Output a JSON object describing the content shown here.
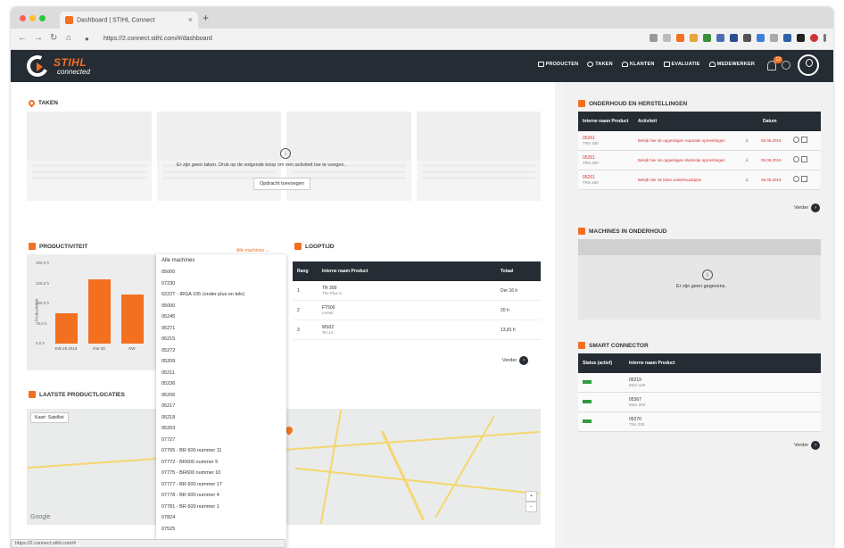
{
  "browser": {
    "tab_title": "Dashboard | STIHL Connect",
    "url": "https://2.connect.stihl.com/#/dashboard",
    "status_url": "https://2.connect.stihl.com/#"
  },
  "header": {
    "brand": "STIHL",
    "brand_sub": "connected",
    "menu": [
      "PRODUCTEN",
      "TAKEN",
      "KLANTEN",
      "EVALUATIE",
      "MEDEWERKER"
    ],
    "notification_count": "12"
  },
  "taken": {
    "title": "TAKEN",
    "message": "Er zijn geen taken. Druk op de volgende knop om een activiteit toe te voegen.",
    "button": "Opdracht toevoegen"
  },
  "productiviteit": {
    "title": "PRODUCTIVITEIT",
    "dropdown_value": "Alle machines",
    "chart_data": {
      "type": "bar",
      "ylabel": "Productiviteit",
      "yticks": [
        "300,0 h",
        "225,0 h",
        "150,0 h",
        "75,0 h",
        "0,0 h"
      ],
      "categories": [
        "KW 29 2019",
        "KW 30",
        "KW"
      ],
      "values": [
        115,
        240,
        185
      ],
      "ylim": [
        0,
        300
      ]
    },
    "machines": [
      "Alle machines",
      "05000",
      "07230",
      "0222T - IRGA 105 (onder plus en tele)",
      "05000",
      "05245",
      "05271",
      "05215",
      "05272",
      "05209",
      "05211",
      "05236",
      "05206",
      "05217",
      "05218",
      "05203",
      "07727",
      "07765 - BR 600 nummer 11",
      "07772 - BR600 nummer 5",
      "07775 - BR600 nummer 10",
      "07777 - BR 600 nummer 17",
      "07778 - BR 600 nummer 4",
      "07781 - BR 600 nummer 1",
      "07824",
      "07525"
    ]
  },
  "looptijd": {
    "title": "LOOPTIJD",
    "columns": [
      "Rang",
      "Interne naam Product",
      "Totaal"
    ],
    "rows": [
      {
        "rank": "1",
        "name": "TR 300",
        "sub": "The Plus S",
        "total": "Der 16 h"
      },
      {
        "rank": "2",
        "name": "FT500",
        "sub": "Lenter",
        "total": "20 h"
      },
      {
        "rank": "3",
        "name": "MS02",
        "sub": "Tel 14",
        "total": "13,81 h"
      }
    ],
    "more": "Verder"
  },
  "locaties": {
    "title": "LAATSTE PRODUCTLOCATIES",
    "map_type": "Kaart",
    "satellite": "Satelliet",
    "google": "Google"
  },
  "onderhoud": {
    "title": "ONDERHOUD EN HERSTELLINGEN",
    "columns": [
      "Interne naam Product",
      "Activiteit",
      "Datum"
    ],
    "rows": [
      {
        "code": "05261",
        "sub": "TRS 400",
        "activity": "Bekijk hier de opgeslagen reparatie opmerkingen",
        "date": "05.06.2019"
      },
      {
        "code": "05261",
        "sub": "TRS 400",
        "activity": "Bekijk hier de opgeslagen klantvrije opmerkingen",
        "date": "05.06.2019"
      },
      {
        "code": "05261",
        "sub": "TRS 400",
        "activity": "Bekijk hier de klant onderhoudsplan",
        "date": "05.06.2019"
      }
    ],
    "more": "Verder"
  },
  "machines_onderhoud": {
    "title": "MACHINES IN ONDERHOUD",
    "message": "Er zijn geen gegevens."
  },
  "smart_connector": {
    "title": "SMART CONNECTOR",
    "columns": [
      "Status (actief)",
      "Interne naam Product"
    ],
    "rows": [
      {
        "name": "05219",
        "sub": "MSA 120"
      },
      {
        "name": "05367",
        "sub": "MSA 200"
      },
      {
        "name": "05270",
        "sub": "TSA 230"
      }
    ],
    "more": "Verder"
  },
  "colors": {
    "accent": "#f37021",
    "header": "#262c33",
    "red": "#d32f2f",
    "green": "#2e9b3c"
  }
}
